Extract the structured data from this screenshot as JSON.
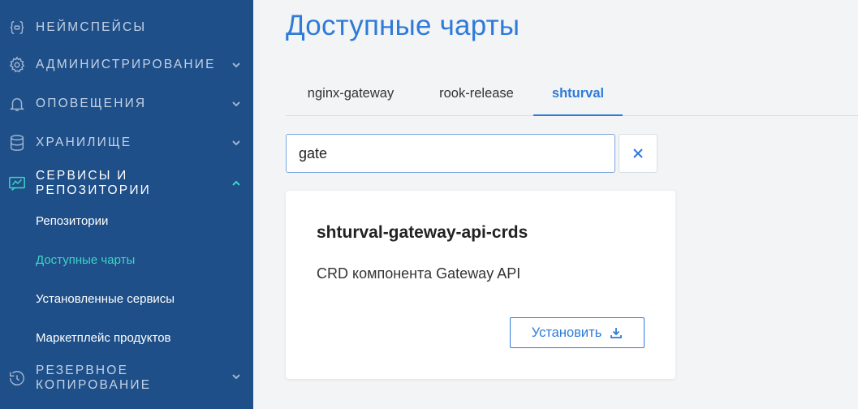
{
  "sidebar": {
    "sections": [
      {
        "label": "НЕЙМСПЕЙСЫ",
        "icon": "braces-icon",
        "expanded": null
      },
      {
        "label": "АДМИНИСТРИРОВАНИЕ",
        "icon": "gear-icon",
        "expanded": false
      },
      {
        "label": "ОПОВЕЩЕНИЯ",
        "icon": "bell-icon",
        "expanded": false
      },
      {
        "label": "ХРАНИЛИЩЕ",
        "icon": "database-icon",
        "expanded": false
      },
      {
        "label_line1": "СЕРВИСЫ И",
        "label_line2": "РЕПОЗИТОРИИ",
        "icon": "services-icon",
        "expanded": true
      },
      {
        "label_line1": "РЕЗЕРВНОЕ",
        "label_line2": "КОПИРОВАНИЕ",
        "icon": "backup-icon",
        "expanded": false
      }
    ],
    "sub_items": [
      {
        "label": "Репозитории",
        "current": false
      },
      {
        "label": "Доступные чарты",
        "current": true
      },
      {
        "label": "Установленные сервисы",
        "current": false
      },
      {
        "label": "Маркетплейс продуктов",
        "current": false
      }
    ]
  },
  "main": {
    "title": "Доступные чарты",
    "tabs": [
      {
        "label": "nginx-gateway",
        "active": false
      },
      {
        "label": "rook-release",
        "active": false
      },
      {
        "label": "shturval",
        "active": true
      }
    ],
    "search": {
      "value": "gate"
    },
    "card": {
      "title": "shturval-gateway-api-crds",
      "description": "CRD компонента Gateway API",
      "install_label": "Установить"
    }
  },
  "colors": {
    "sidebar_bg": "#1e4f88",
    "accent": "#2f7bd8",
    "active_teal": "#3fd4c8"
  }
}
